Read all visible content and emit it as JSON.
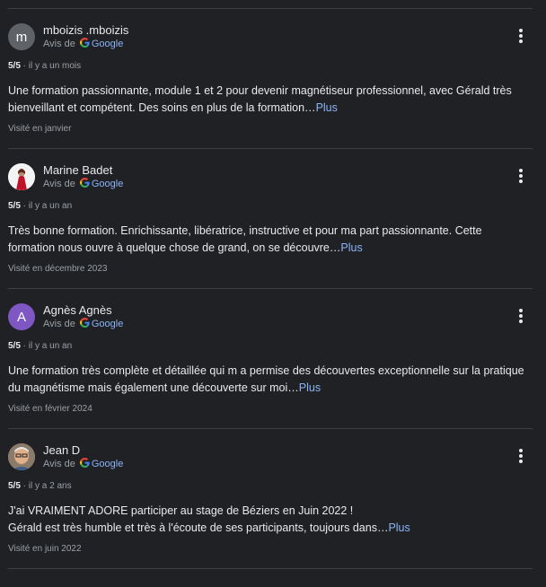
{
  "reviews": [
    {
      "author": "mboizis .mboizis",
      "source_prefix": "Avis de",
      "source_name": "Google",
      "avatar_letter": "m",
      "avatar_color": "#5f6368",
      "rating": "5/5",
      "time": "il y a un mois",
      "text_line1": "Une formation passionnante, module 1 et 2 pour devenir magnétiseur professionnel, avec Gérald très",
      "text_line2": "bienveillant et compétent. Des soins en plus de la formation…",
      "more": "Plus",
      "visited": "Visité en janvier"
    },
    {
      "author": "Marine Badet",
      "source_prefix": "Avis de",
      "source_name": "Google",
      "avatar_letter": "",
      "avatar_color": "#f1f1f1",
      "rating": "5/5",
      "time": "il y a un an",
      "text_line1": "Très bonne formation. Enrichissante, libératrice, instructive et pour ma part passionnante. Cette",
      "text_line2": "formation nous ouvre à quelque chose de grand, on se découvre…",
      "more": "Plus",
      "visited": "Visité en décembre 2023"
    },
    {
      "author": "Agnès Agnès",
      "source_prefix": "Avis de",
      "source_name": "Google",
      "avatar_letter": "A",
      "avatar_color": "#7e57c2",
      "rating": "5/5",
      "time": "il y a un an",
      "text_line1": "Une formation très complète et détaillée qui m a permise des découvertes exceptionnelle sur la pratique",
      "text_line2": "du magnétisme mais également une découverte sur moi…",
      "more": "Plus",
      "visited": "Visité en février 2024"
    },
    {
      "author": "Jean D",
      "source_prefix": "Avis de",
      "source_name": "Google",
      "avatar_letter": "",
      "avatar_color": "#c9a27a",
      "rating": "5/5",
      "time": "il y a 2 ans",
      "text_line1": "J'ai VRAIMENT ADORE participer au stage de Béziers en Juin 2022 !",
      "text_line2": "Gérald est très humble et très à l'écoute de ses participants, toujours dans…",
      "more": "Plus",
      "visited": "Visité en juin 2022"
    }
  ],
  "separator": " · ",
  "colors": {
    "background": "#202124",
    "text": "#e8eaed",
    "secondary": "#9aa0a6",
    "link": "#8ab4f8",
    "divider": "#3c4043"
  }
}
